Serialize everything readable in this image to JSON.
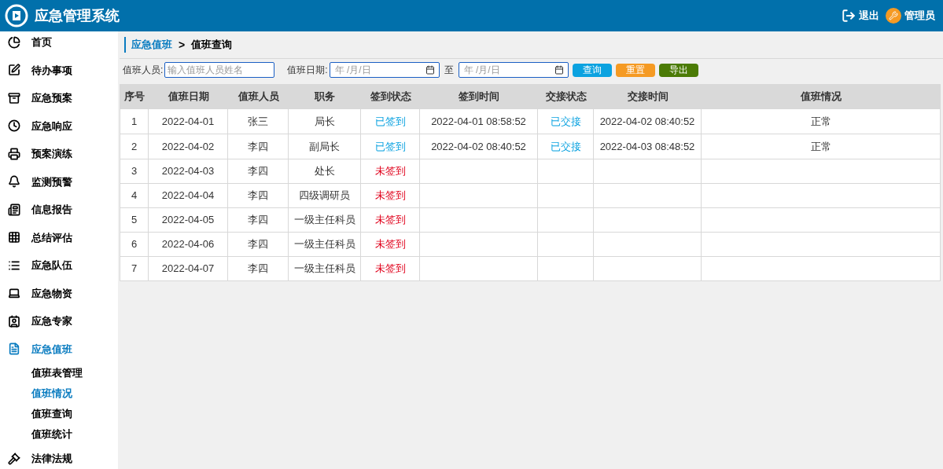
{
  "header": {
    "title": "应急管理系统",
    "logout": "退出",
    "user": "管理员"
  },
  "sidebar": {
    "items": [
      {
        "label": "首页",
        "selected": false
      },
      {
        "label": "待办事项",
        "selected": false
      },
      {
        "label": "应急预案",
        "selected": false
      },
      {
        "label": "应急响应",
        "selected": false
      },
      {
        "label": "预案演练",
        "selected": false
      },
      {
        "label": "监测预警",
        "selected": false
      },
      {
        "label": "信息报告",
        "selected": false
      },
      {
        "label": "总结评估",
        "selected": false
      },
      {
        "label": "应急队伍",
        "selected": false
      },
      {
        "label": "应急物资",
        "selected": false
      },
      {
        "label": "应急专家",
        "selected": false
      },
      {
        "label": "应急值班",
        "selected": true,
        "children": [
          {
            "label": "值班表管理",
            "selected": false
          },
          {
            "label": "值班情况",
            "selected": true
          },
          {
            "label": "值班查询",
            "selected": false
          },
          {
            "label": "值班统计",
            "selected": false
          }
        ]
      },
      {
        "label": "法律法规",
        "selected": false
      }
    ]
  },
  "breadcrumb": {
    "parent": "应急值班",
    "separator": ">",
    "current": "值班查询"
  },
  "filters": {
    "person_label": "值班人员:",
    "person_placeholder": "输入值班人员姓名",
    "date_label": "值班日期:",
    "date_from_placeholder": "年 /月/日",
    "to_label": "至",
    "date_to_placeholder": "年 /月/日",
    "buttons": [
      {
        "label": "查询",
        "kind": "query"
      },
      {
        "label": "重置",
        "kind": "reset"
      },
      {
        "label": "导出",
        "kind": "export"
      }
    ]
  },
  "table": {
    "columns": [
      "序号",
      "值班日期",
      "值班人员",
      "职务",
      "签到状态",
      "签到时间",
      "交接状态",
      "交接时间",
      "值班情况"
    ],
    "rows": [
      {
        "no": "1",
        "date": "2022-04-01",
        "person": "张三",
        "position": "局长",
        "sign_status": {
          "text": "已签到",
          "done": true
        },
        "sign_time": "2022-04-01 08:58:52",
        "handover_status": {
          "text": "已交接",
          "done": true
        },
        "handover_time": "2022-04-02 08:40:52",
        "situation": "正常"
      },
      {
        "no": "2",
        "date": "2022-04-02",
        "person": "李四",
        "position": "副局长",
        "sign_status": {
          "text": "已签到",
          "done": true
        },
        "sign_time": "2022-04-02 08:40:52",
        "handover_status": {
          "text": "已交接",
          "done": true
        },
        "handover_time": "2022-04-03 08:48:52",
        "situation": "正常"
      },
      {
        "no": "3",
        "date": "2022-04-03",
        "person": "李四",
        "position": "处长",
        "sign_status": {
          "text": "未签到",
          "done": false
        }
      },
      {
        "no": "4",
        "date": "2022-04-04",
        "person": "李四",
        "position": "四级调研员",
        "sign_status": {
          "text": "未签到",
          "done": false
        }
      },
      {
        "no": "5",
        "date": "2022-04-05",
        "person": "李四",
        "position": "一级主任科员",
        "sign_status": {
          "text": "未签到",
          "done": false
        }
      },
      {
        "no": "6",
        "date": "2022-04-06",
        "person": "李四",
        "position": "一级主任科员",
        "sign_status": {
          "text": "未签到",
          "done": false
        }
      },
      {
        "no": "7",
        "date": "2022-04-07",
        "person": "李四",
        "position": "一级主任科员",
        "sign_status": {
          "text": "未签到",
          "done": false
        }
      }
    ]
  }
}
